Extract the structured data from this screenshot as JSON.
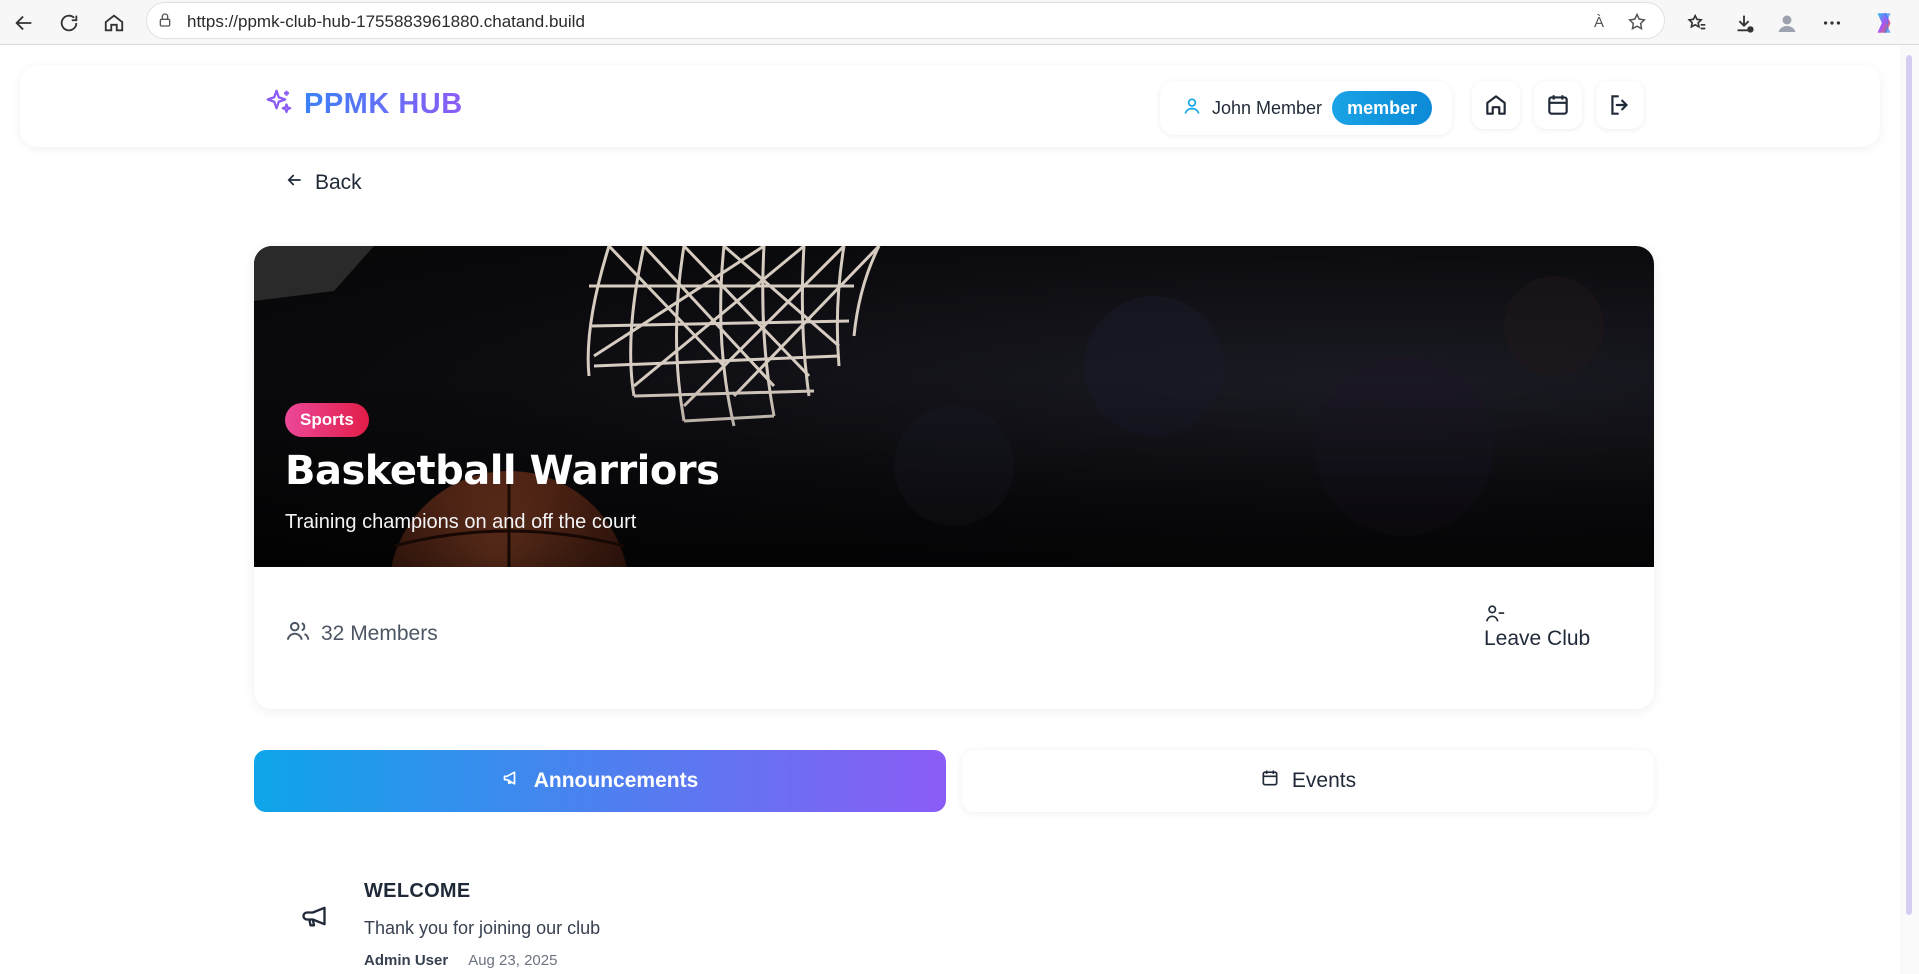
{
  "browser": {
    "url": "https://ppmk-club-hub-1755883961880.chatand.build",
    "read_aloud_label": "À"
  },
  "header": {
    "brand": "PPMK HUB",
    "user_name": "John Member",
    "role": "member"
  },
  "back_label": "Back",
  "club": {
    "category": "Sports",
    "title": "Basketball Warriors",
    "tagline": "Training champions on and off the court",
    "members_label": "32 Members",
    "leave_label": "Leave Club"
  },
  "tabs": {
    "announcements": "Announcements",
    "events": "Events"
  },
  "announcement": {
    "title": "WELCOME",
    "body": "Thank you for joining our club",
    "author": "Admin User",
    "date": "Aug 23, 2025"
  },
  "colors": {
    "brand_gradient_start": "#3b82f6",
    "brand_gradient_end": "#8b5cf6",
    "role_badge": "#0c8ad6",
    "category_badge": "#ec4899"
  }
}
